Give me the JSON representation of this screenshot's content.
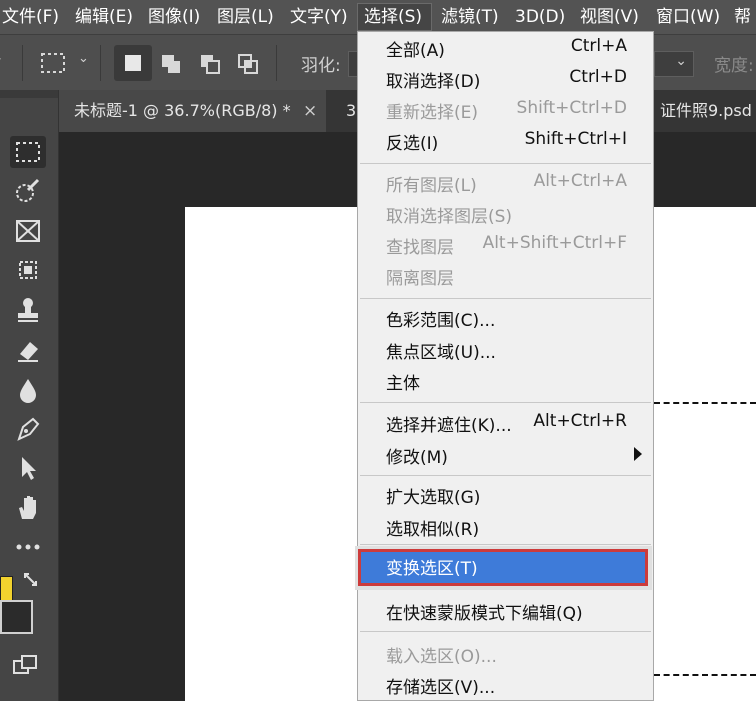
{
  "menubar": {
    "items": [
      {
        "label": "文件(F)"
      },
      {
        "label": "编辑(E)"
      },
      {
        "label": "图像(I)"
      },
      {
        "label": "图层(L)"
      },
      {
        "label": "文字(Y)"
      },
      {
        "label": "选择(S)"
      },
      {
        "label": "滤镜(T)"
      },
      {
        "label": "3D(D)"
      },
      {
        "label": "视图(V)"
      },
      {
        "label": "窗口(W)"
      },
      {
        "label": "帮"
      }
    ]
  },
  "options_bar": {
    "feather_label": "羽化:",
    "width_label": "宽度:"
  },
  "tabs": [
    {
      "label": "未标题-1 @ 36.7%(RGB/8) *",
      "close": "×"
    },
    {
      "label": "证件照9.psd"
    }
  ],
  "select_menu": {
    "groups": [
      [
        {
          "label": "全部(A)",
          "shortcut": "Ctrl+A",
          "disabled": false
        },
        {
          "label": "取消选择(D)",
          "shortcut": "Ctrl+D",
          "disabled": false
        },
        {
          "label": "重新选择(E)",
          "shortcut": "Shift+Ctrl+D",
          "disabled": true
        },
        {
          "label": "反选(I)",
          "shortcut": "Shift+Ctrl+I",
          "disabled": false
        }
      ],
      [
        {
          "label": "所有图层(L)",
          "shortcut": "Alt+Ctrl+A",
          "disabled": true
        },
        {
          "label": "取消选择图层(S)",
          "shortcut": "",
          "disabled": true
        },
        {
          "label": "查找图层",
          "shortcut": "Alt+Shift+Ctrl+F",
          "disabled": true
        },
        {
          "label": "隔离图层",
          "shortcut": "",
          "disabled": true
        }
      ],
      [
        {
          "label": "色彩范围(C)...",
          "shortcut": "",
          "disabled": false
        },
        {
          "label": "焦点区域(U)...",
          "shortcut": "",
          "disabled": false
        },
        {
          "label": "主体",
          "shortcut": "",
          "disabled": false
        }
      ],
      [
        {
          "label": "选择并遮住(K)...",
          "shortcut": "Alt+Ctrl+R",
          "disabled": false
        },
        {
          "label": "修改(M)",
          "shortcut": "",
          "disabled": false,
          "submenu": true
        }
      ],
      [
        {
          "label": "扩大选取(G)",
          "shortcut": "",
          "disabled": false
        },
        {
          "label": "选取相似(R)",
          "shortcut": "",
          "disabled": false
        }
      ],
      [
        {
          "label": "变换选区(T)",
          "shortcut": "",
          "disabled": false,
          "highlighted": true
        }
      ],
      [
        {
          "label": "在快速蒙版模式下编辑(Q)",
          "shortcut": "",
          "disabled": false
        }
      ],
      [
        {
          "label": "载入选区(O)...",
          "shortcut": "",
          "disabled": true
        },
        {
          "label": "存储选区(V)...",
          "shortcut": "",
          "disabled": false
        }
      ]
    ]
  },
  "colors": {
    "highlight": "#3e7bd9",
    "highlight_border": "#cc3b3b",
    "foreground_swatch": "#f2d22e",
    "background_swatch": "#2b2b2b"
  }
}
